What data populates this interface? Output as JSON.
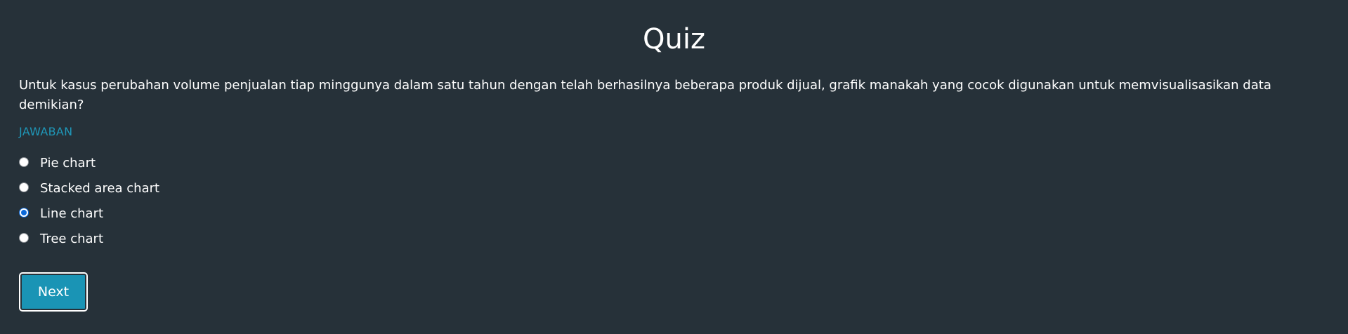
{
  "quiz": {
    "title": "Quiz",
    "question": "Untuk kasus perubahan volume penjualan tiap minggunya dalam satu tahun dengan telah berhasilnya beberapa produk dijual, grafik manakah yang cocok digunakan untuk memvisualisasikan data demikian?",
    "answer_label": "JAWABAN",
    "options": [
      {
        "label": "Pie chart",
        "selected": false
      },
      {
        "label": "Stacked area chart",
        "selected": false
      },
      {
        "label": "Line chart",
        "selected": true
      },
      {
        "label": "Tree chart",
        "selected": false
      }
    ],
    "next_label": "Next"
  },
  "colors": {
    "background": "#263139",
    "accent": "#1a94b5",
    "answer_label": "#1f97b8",
    "radio_selected": "#0b68d8",
    "text": "#ffffff"
  }
}
